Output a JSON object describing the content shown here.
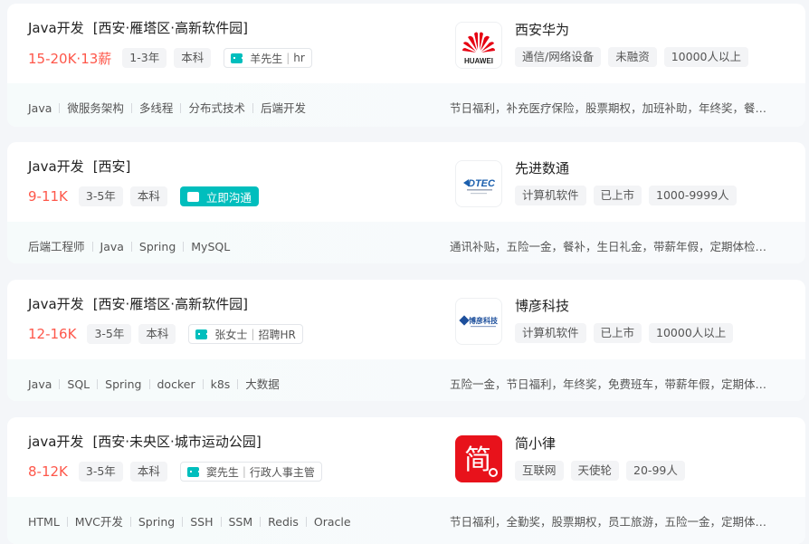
{
  "jobs": [
    {
      "title": "Java开发",
      "city": "[西安·雁塔区·高新软件园]",
      "salary": "15-20K·13薪",
      "exp": "1-3年",
      "edu": "本科",
      "hr_name": "羊先生",
      "hr_title": "hr",
      "skills": [
        "Java",
        "微服务架构",
        "多线程",
        "分布式技术",
        "后端开发"
      ],
      "company": "西安华为",
      "company_tags": [
        "通信/网络设备",
        "未融资",
        "10000人以上"
      ],
      "welfare": "节日福利，补充医疗保险，股票期权，加班补助，年终奖，餐补，定期体检",
      "logo_text": "HUAWEI"
    },
    {
      "title": "Java开发",
      "city": "[西安]",
      "salary": "9-11K",
      "exp": "3-5年",
      "edu": "本科",
      "chat_btn": "立即沟通",
      "skills": [
        "后端工程师",
        "Java",
        "Spring",
        "MySQL"
      ],
      "company": "先进数通",
      "company_tags": [
        "计算机软件",
        "已上市",
        "1000-9999人"
      ],
      "welfare": "通讯补贴，五险一金，餐补，生日礼金，带薪年假，定期体检，节日福利",
      "logo_text": "DTEC"
    },
    {
      "title": "Java开发",
      "city": "[西安·雁塔区·高新软件园]",
      "salary": "12-16K",
      "exp": "3-5年",
      "edu": "本科",
      "hr_name": "张女士",
      "hr_title": "招聘HR",
      "skills": [
        "Java",
        "SQL",
        "Spring",
        "docker",
        "k8s",
        "大数据"
      ],
      "company": "博彦科技",
      "company_tags": [
        "计算机软件",
        "已上市",
        "10000人以上"
      ],
      "welfare": "五险一金，节日福利，年终奖，免费班车，带薪年假，定期体检，餐补",
      "logo_text": "博彦科技"
    },
    {
      "title": "java开发",
      "city": "[西安·未央区·城市运动公园]",
      "salary": "8-12K",
      "exp": "3-5年",
      "edu": "本科",
      "hr_name": "窦先生",
      "hr_title": "行政人事主管",
      "skills": [
        "HTML",
        "MVC开发",
        "Spring",
        "SSH",
        "SSM",
        "Redis",
        "Oracle"
      ],
      "company": "简小律",
      "company_tags": [
        "互联网",
        "天使轮",
        "20-99人"
      ],
      "welfare": "节日福利，全勤奖，股票期权，员工旅游，五险一金，定期体检，带薪年假",
      "logo_text": "简"
    }
  ],
  "colors": {
    "salary": "#fe574a",
    "accent": "#00bebd"
  }
}
